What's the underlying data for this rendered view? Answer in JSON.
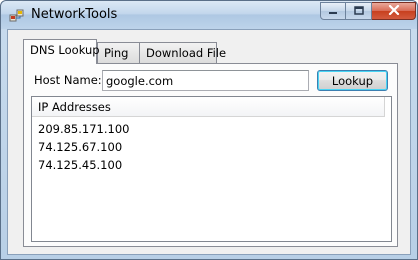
{
  "window": {
    "title": "NetworkTools",
    "icons": {
      "app": "network-app-icon",
      "minimize": "minimize-icon",
      "maximize": "maximize-icon",
      "close": "close-icon"
    },
    "colors": {
      "title_bar": "#c3d7ec",
      "close_button": "#c7401f",
      "client_bg": "#f0f0f0",
      "button_focus": "#3c7fb1"
    }
  },
  "tabs": [
    {
      "label": "DNS Lookup",
      "selected": true
    },
    {
      "label": "Ping",
      "selected": false
    },
    {
      "label": "Download File",
      "selected": false
    }
  ],
  "dns_lookup": {
    "host_label": "Host Name:",
    "host_value": "google.com",
    "lookup_button": "Lookup",
    "results": {
      "column_header": "IP Addresses",
      "rows": [
        "209.85.171.100",
        "74.125.67.100",
        "74.125.45.100"
      ]
    }
  }
}
